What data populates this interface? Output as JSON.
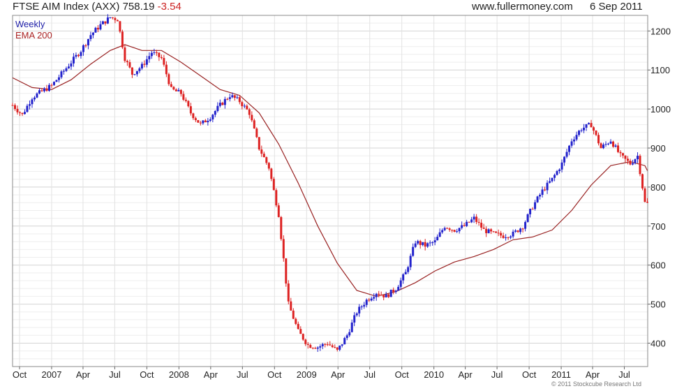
{
  "header": {
    "title_prefix": "FTSE AIM Index (AXX)",
    "last": "758.19",
    "change": "-3.54",
    "website": "www.fullermoney.com",
    "date": "6 Sep 2011"
  },
  "legend": {
    "weekly": "Weekly",
    "ema": "EMA 200"
  },
  "footer": {
    "copyright": "© 2011 Stockcube Research Ltd"
  },
  "colors": {
    "up": "#2222cc",
    "down": "#dd2222",
    "ema": "#992222",
    "grid": "#dddddd"
  },
  "chart_data": {
    "type": "line",
    "x_tick_labels": [
      "Oct",
      "2007",
      "Apr",
      "Jul",
      "Oct",
      "2008",
      "Apr",
      "Jul",
      "Oct",
      "2009",
      "Apr",
      "Jul",
      "Oct",
      "2010",
      "Apr",
      "Jul",
      "Oct",
      "2011",
      "Apr",
      "Jul"
    ],
    "x_tick_dates": [
      "2006-10-01",
      "2007-01-01",
      "2007-04-01",
      "2007-07-01",
      "2007-10-01",
      "2008-01-01",
      "2008-04-01",
      "2008-07-01",
      "2008-10-01",
      "2009-01-01",
      "2009-04-01",
      "2009-07-01",
      "2009-10-01",
      "2010-01-01",
      "2010-04-01",
      "2010-07-01",
      "2010-10-01",
      "2011-01-01",
      "2011-04-01",
      "2011-07-01"
    ],
    "y_ticks": [
      400,
      500,
      600,
      700,
      800,
      900,
      1000,
      1100,
      1200
    ],
    "ylim": [
      340,
      1240
    ],
    "xlim": [
      "2006-09-11",
      "2011-09-06"
    ],
    "grid": true,
    "scale": "linear",
    "series": [
      {
        "name": "Weekly",
        "style": "weekly-bars",
        "x": [
          "2006-09-11",
          "2006-10-09",
          "2006-11-06",
          "2006-12-04",
          "2007-01-01",
          "2007-01-29",
          "2007-02-26",
          "2007-03-26",
          "2007-04-23",
          "2007-05-21",
          "2007-06-18",
          "2007-07-09",
          "2007-07-30",
          "2007-08-20",
          "2007-09-17",
          "2007-10-15",
          "2007-11-12",
          "2007-12-10",
          "2008-01-07",
          "2008-02-04",
          "2008-03-03",
          "2008-03-31",
          "2008-04-28",
          "2008-05-26",
          "2008-06-23",
          "2008-07-21",
          "2008-08-18",
          "2008-09-15",
          "2008-10-13",
          "2008-11-10",
          "2008-12-08",
          "2009-01-05",
          "2009-02-02",
          "2009-03-02",
          "2009-03-30",
          "2009-04-27",
          "2009-05-25",
          "2009-06-22",
          "2009-07-20",
          "2009-08-17",
          "2009-09-14",
          "2009-10-12",
          "2009-11-09",
          "2009-12-07",
          "2010-01-04",
          "2010-02-01",
          "2010-03-01",
          "2010-03-29",
          "2010-04-26",
          "2010-05-24",
          "2010-06-21",
          "2010-07-19",
          "2010-08-16",
          "2010-09-13",
          "2010-10-11",
          "2010-11-08",
          "2010-12-06",
          "2011-01-03",
          "2011-01-31",
          "2011-02-28",
          "2011-03-28",
          "2011-04-25",
          "2011-05-23",
          "2011-06-20",
          "2011-07-18",
          "2011-08-08",
          "2011-08-29",
          "2011-09-05"
        ],
        "values": [
          1010,
          985,
          1030,
          1045,
          1060,
          1090,
          1120,
          1150,
          1190,
          1215,
          1235,
          1230,
          1130,
          1090,
          1110,
          1145,
          1130,
          1050,
          1040,
          990,
          960,
          980,
          1010,
          1035,
          1020,
          990,
          900,
          850,
          730,
          500,
          430,
          395,
          390,
          400,
          380,
          420,
          480,
          510,
          530,
          520,
          540,
          580,
          660,
          650,
          660,
          700,
          690,
          700,
          720,
          690,
          680,
          675,
          680,
          700,
          750,
          790,
          820,
          860,
          920,
          950,
          960,
          900,
          920,
          880,
          860,
          880,
          760,
          758
        ]
      },
      {
        "name": "EMA 200",
        "style": "line",
        "x": [
          "2006-09-11",
          "2006-11-06",
          "2007-01-01",
          "2007-02-26",
          "2007-04-23",
          "2007-06-18",
          "2007-07-30",
          "2007-09-17",
          "2007-11-12",
          "2008-01-07",
          "2008-03-03",
          "2008-04-28",
          "2008-06-23",
          "2008-08-18",
          "2008-10-13",
          "2008-12-08",
          "2009-02-02",
          "2009-03-30",
          "2009-05-25",
          "2009-07-20",
          "2009-09-14",
          "2009-11-09",
          "2010-01-04",
          "2010-03-01",
          "2010-04-26",
          "2010-06-21",
          "2010-08-16",
          "2010-10-11",
          "2010-12-06",
          "2011-01-31",
          "2011-03-28",
          "2011-05-23",
          "2011-07-18",
          "2011-08-29",
          "2011-09-05"
        ],
        "values": [
          1080,
          1055,
          1050,
          1075,
          1115,
          1150,
          1165,
          1150,
          1150,
          1120,
          1085,
          1050,
          1035,
          990,
          910,
          810,
          700,
          605,
          535,
          520,
          532,
          555,
          585,
          608,
          622,
          640,
          665,
          672,
          690,
          740,
          805,
          855,
          865,
          855,
          842
        ]
      }
    ]
  }
}
